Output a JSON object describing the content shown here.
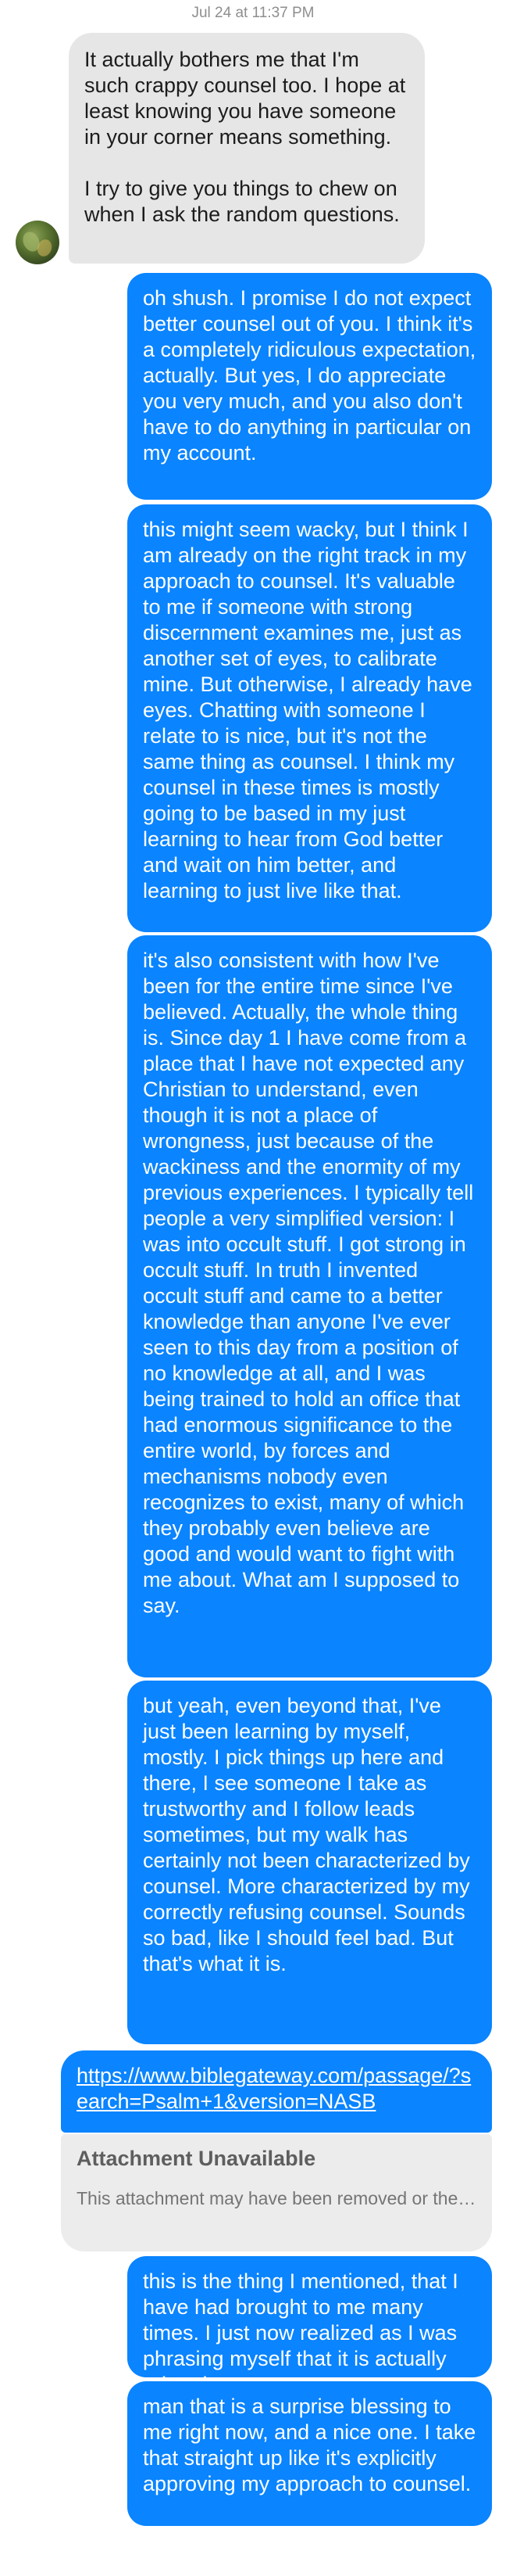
{
  "timestamp": "Jul 24 at 11:37 PM",
  "messages": {
    "m1": "It actually bothers me that I'm such crappy counsel too. I hope at least knowing you have someone in your corner means something.\n\nI try to give you things to chew on when I ask the random questions.",
    "m2": "oh shush. I promise I do not expect better counsel out of you. I think it's a completely ridiculous expectation, actually. But yes, I do appreciate you very much, and you also don't have to do anything in particular on my account.",
    "m3": "this might seem wacky, but I think I am already on the right track in my approach to counsel. It's valuable to me if someone with strong discernment examines me, just as another set of eyes, to calibrate mine. But otherwise, I already have eyes. Chatting with someone I relate to is nice, but it's not the same thing as counsel. I think my counsel in these times is mostly going to be based in my just learning to hear from God better and wait on him better, and learning to just live like that.",
    "m4": "it's also consistent with how I've been for the entire time since I've believed. Actually, the whole thing is. Since day 1 I have come from a place that I have not expected any Christian to understand, even though it is not a place of wrongness, just because of the wackiness and the enormity of my previous experiences. I typically tell people a very simplified version: I was into occult stuff. I got strong in occult stuff. In truth I invented occult stuff and came to a better knowledge than anyone I've ever seen to this day from a position of no knowledge at all, and I was being trained to hold an office that had enormous significance to the entire world, by forces and mechanisms nobody even recognizes to exist, many of which they probably even believe are good and would want to fight with me about. What am I supposed to say.",
    "m5": "but yeah, even beyond that, I've just been learning by myself, mostly. I pick things up here and there, I see someone I take as trustworthy and I follow leads sometimes, but my walk has certainly not been characterized by counsel. More characterized by my correctly refusing counsel. Sounds so bad, like I should feel bad. But that's what it is.",
    "link": "https://www.biblegateway.com/passage/?search=Psalm+1&version=NASB",
    "attachment_title": "Attachment Unavailable",
    "attachment_desc": "This attachment may have been removed or the person who shared it may not have p…",
    "m6": "this is the thing I mentioned, that I have had brought to me many times. I just now realized as I was phrasing myself that it is actually related.",
    "m7": "man that is a surprise blessing to me right now, and a nice one. I take that straight up like it's explicitly approving my approach to counsel."
  },
  "colors": {
    "sent_bubble": "#0a84ff",
    "received_bubble": "#e6e6e6",
    "attachment_bubble": "#ececec"
  }
}
